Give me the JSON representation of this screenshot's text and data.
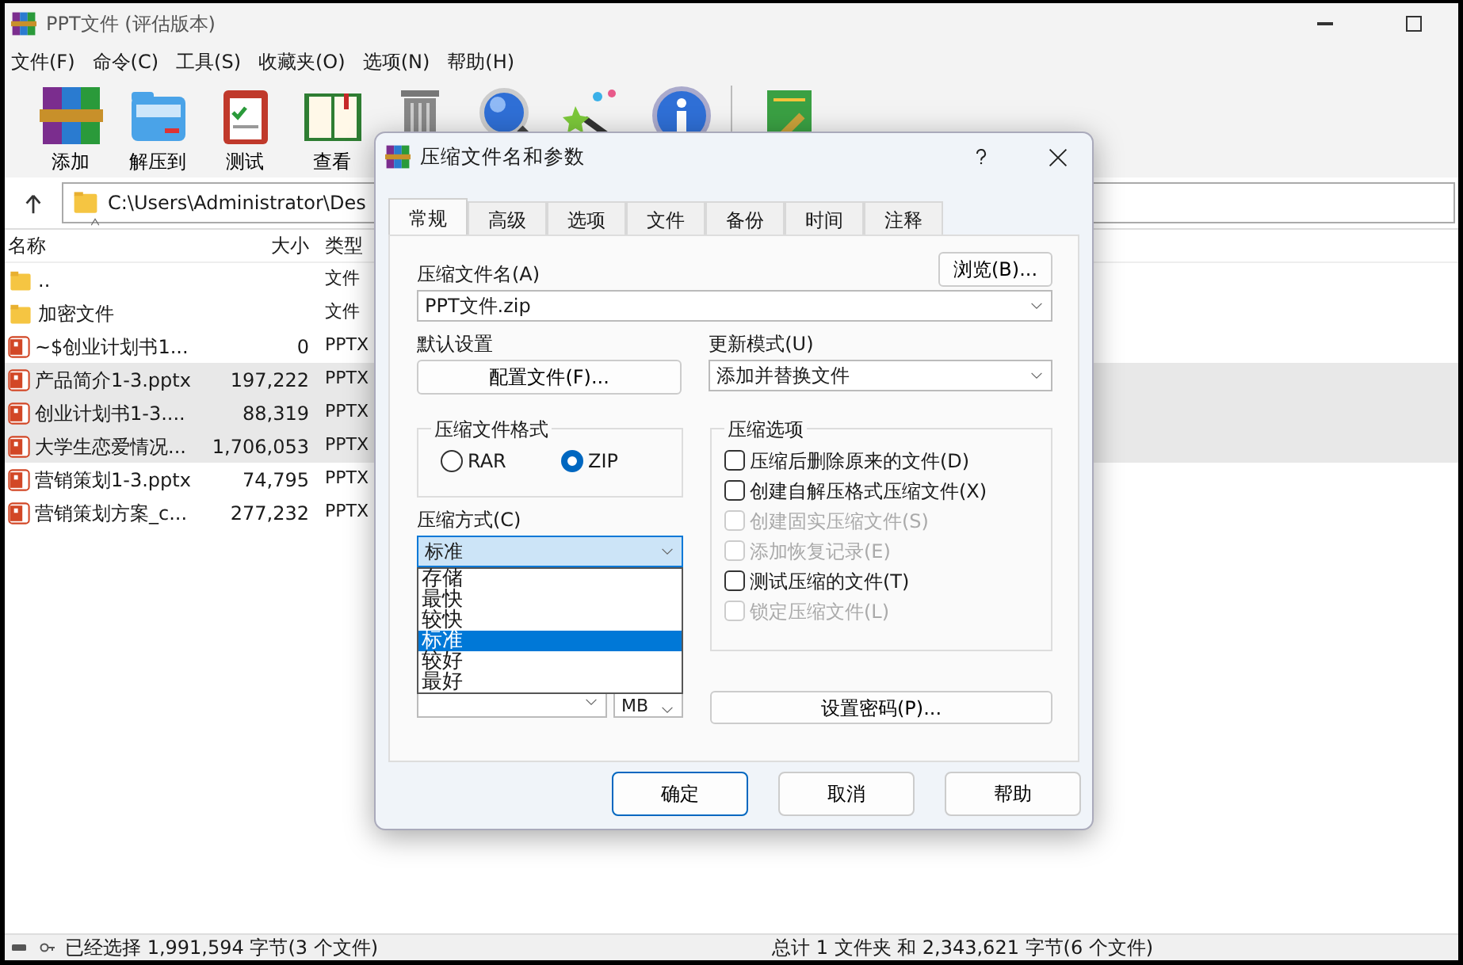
{
  "window": {
    "title": "PPT文件 (评估版本)"
  },
  "menu": [
    "文件(F)",
    "命令(C)",
    "工具(S)",
    "收藏夹(O)",
    "选项(N)",
    "帮助(H)"
  ],
  "toolbar": [
    {
      "kind": "add",
      "label": "添加"
    },
    {
      "kind": "extract",
      "label": "解压到"
    },
    {
      "kind": "test",
      "label": "测试"
    },
    {
      "kind": "view",
      "label": "查看"
    },
    {
      "kind": "delete"
    },
    {
      "kind": "find"
    },
    {
      "kind": "wizard"
    },
    {
      "kind": "info"
    },
    {
      "kind": "repair"
    }
  ],
  "address": {
    "path": "C:\\Users\\Administrator\\Des"
  },
  "file_list": {
    "columns": [
      {
        "label": "名称",
        "sorted": true
      },
      {
        "label": "大小",
        "sorted": false
      },
      {
        "label": "类型",
        "sorted": false
      }
    ],
    "rows": [
      {
        "kind": "folder",
        "name": "..",
        "type": "文件",
        "selected": false
      },
      {
        "kind": "folder",
        "name": "加密文件",
        "type": "文件",
        "selected": false
      },
      {
        "kind": "pptx",
        "name": "~$创业计划书1...",
        "size": "0",
        "type": "PPTX",
        "selected": false
      },
      {
        "kind": "pptx",
        "name": "产品简介1-3.pptx",
        "size": "197,222",
        "type": "PPTX",
        "selected": true
      },
      {
        "kind": "pptx",
        "name": "创业计划书1-3....",
        "size": "88,319",
        "type": "PPTX",
        "selected": true
      },
      {
        "kind": "pptx",
        "name": "大学生恋爱情况...",
        "size": "1,706,053",
        "type": "PPTX",
        "selected": true
      },
      {
        "kind": "pptx",
        "name": "营销策划1-3.pptx",
        "size": "74,795",
        "type": "PPTX",
        "selected": false
      },
      {
        "kind": "pptx",
        "name": "营销策划方案_c...",
        "size": "277,232",
        "type": "PPTX",
        "selected": false
      }
    ]
  },
  "status_bar": {
    "left": "已经选择 1,991,594 字节(3 个文件)",
    "right": "总计 1 文件夹 和 2,343,621 字节(6 个文件)"
  },
  "dialog": {
    "title": "压缩文件名和参数",
    "tabs": [
      {
        "label": "常规",
        "selected": true
      },
      {
        "label": "高级",
        "selected": false
      },
      {
        "label": "选项",
        "selected": false
      },
      {
        "label": "文件",
        "selected": false
      },
      {
        "label": "备份",
        "selected": false
      },
      {
        "label": "时间",
        "selected": false
      },
      {
        "label": "注释",
        "selected": false
      }
    ],
    "archive_name": {
      "label": "压缩文件名(A)",
      "value": "PPT文件.zip",
      "browse_button": "浏览(B)..."
    },
    "default_settings": {
      "label": "默认设置",
      "button": "配置文件(F)..."
    },
    "update_mode": {
      "label": "更新模式(U)",
      "value": "添加并替换文件"
    },
    "archive_format": {
      "label": "压缩文件格式",
      "options": [
        {
          "label": "RAR",
          "selected": false
        },
        {
          "label": "ZIP",
          "selected": true
        }
      ]
    },
    "compression_options": {
      "label": "压缩选项",
      "items": [
        {
          "label": "压缩后删除原来的文件(D)",
          "checked": false,
          "disabled": false
        },
        {
          "label": "创建自解压格式压缩文件(X)",
          "checked": false,
          "disabled": false
        },
        {
          "label": "创建固实压缩文件(S)",
          "checked": false,
          "disabled": true
        },
        {
          "label": "添加恢复记录(E)",
          "checked": false,
          "disabled": true
        },
        {
          "label": "测试压缩的文件(T)",
          "checked": false,
          "disabled": false
        },
        {
          "label": "锁定压缩文件(L)",
          "checked": false,
          "disabled": true
        }
      ]
    },
    "compression_method": {
      "label": "压缩方式(C)",
      "value": "标准",
      "expanded": true,
      "options": [
        {
          "label": "存储",
          "selected": false
        },
        {
          "label": "最快",
          "selected": false
        },
        {
          "label": "较快",
          "selected": false
        },
        {
          "label": "标准",
          "selected": true
        },
        {
          "label": "较好",
          "selected": false
        },
        {
          "label": "最好",
          "selected": false
        }
      ]
    },
    "split": {
      "unit": "MB"
    },
    "password_button": "设置密码(P)...",
    "buttons": [
      {
        "label": "确定",
        "default": true
      },
      {
        "label": "取消",
        "default": false
      },
      {
        "label": "帮助",
        "default": false
      }
    ]
  }
}
